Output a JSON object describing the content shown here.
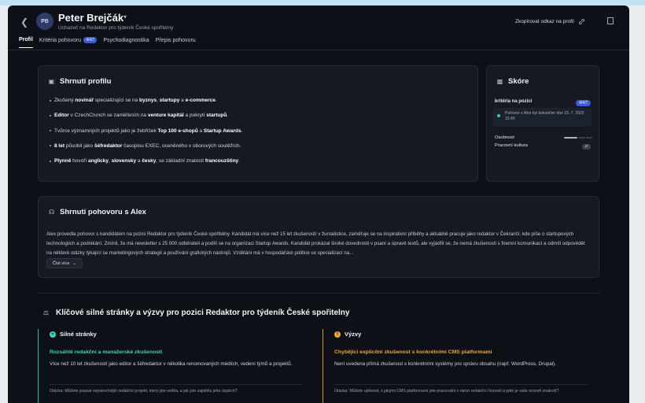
{
  "header": {
    "avatar_initials": "PB",
    "name": "Peter Brejčák",
    "subtitle": "Uchazeč na Redaktor pro týdeník České spořitelny",
    "copy_link_label": "Zkopírovat odkaz na profil"
  },
  "tabs": [
    {
      "label": "Profil",
      "active": true
    },
    {
      "label": "Kritéria pohovoru",
      "badge": "4/4/7"
    },
    {
      "label": "Psychodiagnostika"
    },
    {
      "label": "Přepis pohovoru"
    }
  ],
  "profile_summary": {
    "title": "Shrnutí profilu",
    "items": [
      [
        {
          "t": "Zkušený "
        },
        {
          "t": "novinář",
          "b": true
        },
        {
          "t": " specializující se na "
        },
        {
          "t": "byznys",
          "b": true
        },
        {
          "t": ", "
        },
        {
          "t": "startupy",
          "b": true
        },
        {
          "t": " a "
        },
        {
          "t": "e-commerce",
          "b": true
        },
        {
          "t": "."
        }
      ],
      [
        {
          "t": "Editor",
          "b": true
        },
        {
          "t": " v CzechCrunch se zaměřením na "
        },
        {
          "t": "venture kapitál",
          "b": true
        },
        {
          "t": " a pokrytí "
        },
        {
          "t": "startupů",
          "b": true
        },
        {
          "t": "."
        }
      ],
      [
        {
          "t": "Tvůrce významných projektů jako je žebříček "
        },
        {
          "t": "Top 100 e-shopů",
          "b": true
        },
        {
          "t": " a "
        },
        {
          "t": "Startup Awards",
          "b": true
        },
        {
          "t": "."
        }
      ],
      [
        {
          "t": "8 let",
          "b": true
        },
        {
          "t": " působil jako "
        },
        {
          "t": "šéfredaktor",
          "b": true
        },
        {
          "t": " časopisu EXEC, oceněného v oborových soutěžích."
        }
      ],
      [
        {
          "t": "Plynně",
          "b": true
        },
        {
          "t": " hovoří "
        },
        {
          "t": "anglicky",
          "b": true
        },
        {
          "t": ", "
        },
        {
          "t": "slovensky",
          "b": true
        },
        {
          "t": " a "
        },
        {
          "t": "česky",
          "b": true
        },
        {
          "t": ", se základní znalostí "
        },
        {
          "t": "francouzštiny",
          "b": true
        },
        {
          "t": "."
        }
      ]
    ]
  },
  "score": {
    "title": "Skóre",
    "criteria_label": "kritéria na pozici",
    "criteria_badge": "4/4/7",
    "note": "Pohovor s Alex byl dokončen dne 15. 7. 2025 15:40",
    "personality_label": "Osobnost",
    "culture_label": "Pracovní kultura",
    "culture_icon": "⇄"
  },
  "interview_summary": {
    "title": "Shrnutí pohovoru s Alex",
    "text": "Alex provedla pohovor s kandidátem na pozici Redaktor pro týdeník České spořitelny. Kandidát má více než 15 let zkušeností v žurnalistice, zaměřuje se na inspirativní příběhy a aktuálně pracuje jako redaktor v Čekrančí, kde píše o startupových technologiích a podnikání. Zmínil, že má newsletter s 25 000 odběrateli a podílí se na organizaci Startup Awards. Kandidát prokázal široké dovednosti v psaní a úpravě textů, ale vyjádřil se, že nemá zkušenosti s firemní komunikací a odmítl odpovědět na některé otázky týkající se marketingových strategií a používání grafických nástrojů. Vzdělání má v hospodářské politice se specializací na...",
    "more_label": "Číst více"
  },
  "strengths_section": {
    "title": "Klíčové silné stránky a výzvy pro pozici Redaktor pro týdeník České spořitelny",
    "strengths": {
      "heading": "Silné stránky",
      "item_title": "Rozsáhlé redakční a manažerské zkušenosti",
      "item_text": "Více než 10 let zkušeností jako editor a šéfredaktor v několika renomovaných médiích, vedení týmů a projektů.",
      "question": "Otázka: Můžete popsat nejnáročnější redakční projekt, který jste vedl/a, a jak jste zajistil/a jeho úspěch?"
    },
    "challenges": {
      "heading": "Výzvy",
      "item_title": "Chybějící explicitní zkušenost s konkrétními CMS platformami",
      "item_text": "Není uvedena přímá zkušenost s konkrétními systémy pro správu obsahu (např. WordPress, Drupal).",
      "question": "Otázka: Můžete upřesnit, s jakými CMS platformami jste pracoval/a v rámci redakční činnosti a jaké je vaše úroveň znalostí?"
    }
  },
  "colors": {
    "background": "#0d1117",
    "card": "#151a22",
    "accent_blue": "#3b5bdb",
    "strength_teal": "#3fd3bb",
    "challenge_orange": "#f2a33a"
  },
  "icons": [
    "back-arrow-icon",
    "chevron-down-icon",
    "link-icon",
    "document-icon",
    "clipboard-icon",
    "podium-icon",
    "headset-icon",
    "scale-icon",
    "plus-circle-icon",
    "warning-icon",
    "swap-icon"
  ]
}
